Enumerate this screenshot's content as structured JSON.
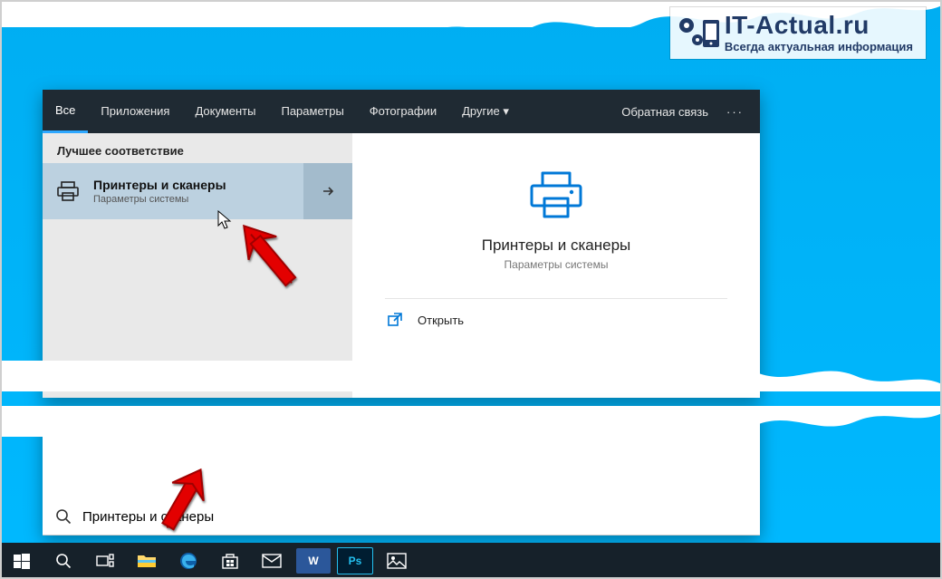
{
  "tabs": {
    "all": "Все",
    "apps": "Приложения",
    "docs": "Документы",
    "settings": "Параметры",
    "photos": "Фотографии",
    "more": "Другие",
    "feedback": "Обратная связь"
  },
  "left": {
    "section": "Лучшее соответствие",
    "result_title": "Принтеры и сканеры",
    "result_sub": "Параметры системы"
  },
  "detail": {
    "title": "Принтеры и сканеры",
    "sub": "Параметры системы",
    "open": "Открыть"
  },
  "search": {
    "value": "Принтеры и сканеры"
  },
  "watermark": {
    "line1": "IT-Actual.ru",
    "line2": "Всегда актуальная информация"
  }
}
